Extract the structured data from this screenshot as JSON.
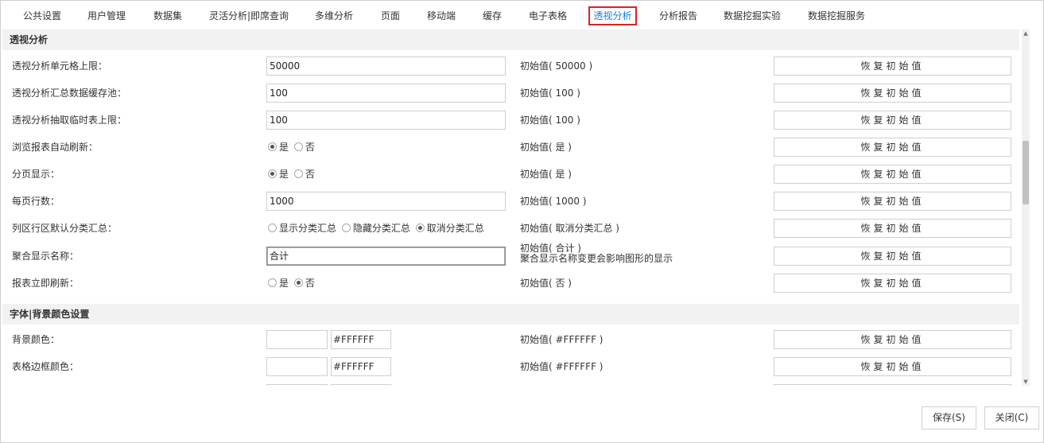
{
  "tabs": [
    "公共设置",
    "用户管理",
    "数据集",
    "灵活分析|即席查询",
    "多维分析",
    "页面",
    "移动端",
    "缓存",
    "电子表格",
    "透视分析",
    "分析报告",
    "数据挖掘实验",
    "数据挖掘服务"
  ],
  "active_tab": "透视分析",
  "sections": {
    "pivot": "透视分析",
    "font": "字体|背景颜色设置"
  },
  "reset_label": "恢复初始值",
  "rows": {
    "cell_limit": {
      "label": "透视分析单元格上限：",
      "value": "50000",
      "init": "初始值( 50000 )"
    },
    "cache_pool": {
      "label": "透视分析汇总数据缓存池：",
      "value": "100",
      "init": "初始值( 100 )"
    },
    "temp_limit": {
      "label": "透视分析抽取临时表上限：",
      "value": "100",
      "init": "初始值( 100 )"
    },
    "auto_refresh": {
      "label": "浏览报表自动刷新：",
      "opt_yes": "是",
      "opt_no": "否",
      "selected": "是",
      "init": "初始值( 是 )"
    },
    "paging": {
      "label": "分页显示：",
      "opt_yes": "是",
      "opt_no": "否",
      "selected": "是",
      "init": "初始值( 是 )"
    },
    "rows_per_page": {
      "label": "每页行数：",
      "value": "1000",
      "init": "初始值( 1000 )"
    },
    "default_subtotal": {
      "label": "列区行区默认分类汇总：",
      "opt1": "显示分类汇总",
      "opt2": "隐藏分类汇总",
      "opt3": "取消分类汇总",
      "selected": "取消分类汇总",
      "init": "初始值( 取消分类汇总 )"
    },
    "agg_name": {
      "label": "聚合显示名称：",
      "value": "合计",
      "init": "初始值( 合计 )",
      "note": "聚合显示名称变更会影响图形的显示"
    },
    "instant_refresh": {
      "label": "报表立即刷新：",
      "opt_yes": "是",
      "opt_no": "否",
      "selected": "否",
      "init": "初始值( 否 )"
    },
    "bg_color": {
      "label": "背景颜色：",
      "hex": "#FFFFFF",
      "init": "初始值( #FFFFFF )"
    },
    "border_color": {
      "label": "表格边框颜色：",
      "hex": "#FFFFFF",
      "init": "初始值( #FFFFFF )"
    }
  },
  "buttons": {
    "save": "保存(S)",
    "close": "关闭(C)"
  },
  "colors": {
    "active_tab_text": "#1a7bd6",
    "active_tab_border": "#e02020",
    "section_bg": "#f2f2f2"
  }
}
